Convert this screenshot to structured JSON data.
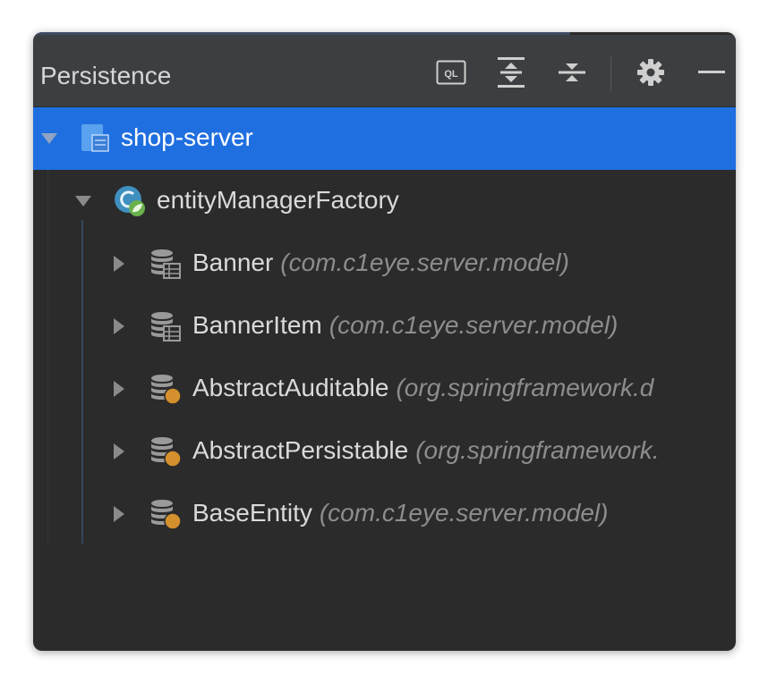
{
  "panel": {
    "title": "Persistence"
  },
  "toolbar": {
    "ql_label": "QL",
    "buttons": [
      {
        "name": "ql-console-icon"
      },
      {
        "name": "expand-all-icon"
      },
      {
        "name": "collapse-all-icon"
      },
      {
        "name": "gear-icon"
      },
      {
        "name": "minimize-icon"
      }
    ]
  },
  "tree": {
    "module": {
      "label": "shop-server",
      "icon": "module-icon",
      "expanded": true
    },
    "factory": {
      "label": "entityManagerFactory",
      "icon": "spring-bean-icon",
      "expanded": true
    },
    "entities": [
      {
        "name": "Banner",
        "package": "(com.c1eye.server.model)",
        "icon": "entity-table-icon"
      },
      {
        "name": "BannerItem",
        "package": "(com.c1eye.server.model)",
        "icon": "entity-table-icon"
      },
      {
        "name": "AbstractAuditable",
        "package": "(org.springframework.d",
        "icon": "mapped-superclass-icon"
      },
      {
        "name": "AbstractPersistable",
        "package": "(org.springframework.",
        "icon": "mapped-superclass-icon"
      },
      {
        "name": "BaseEntity",
        "package": "(com.c1eye.server.model)",
        "icon": "mapped-superclass-icon"
      }
    ]
  },
  "colors": {
    "background": "#2b2b2b",
    "header": "#3c3f41",
    "selection": "#1f6fe0",
    "text": "#dadada",
    "package_text": "#8d8d8d",
    "badge_orange": "#d4902c"
  }
}
